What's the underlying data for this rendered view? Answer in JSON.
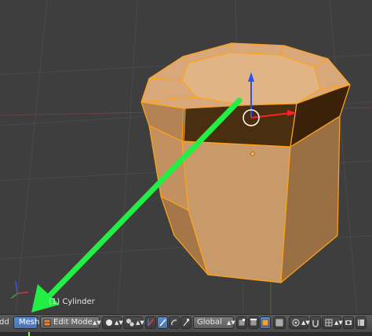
{
  "viewport": {
    "object_name": "(1) Cylinder"
  },
  "header": {
    "left_clip": "dd",
    "menu_mesh": "Mesh",
    "mode": "Edit Mode",
    "orientation": "Global"
  },
  "colors": {
    "mesh_face": "#c89a6a",
    "mesh_edge": "#ffa31a",
    "selected_face": "#4a2e0e",
    "annotation_arrow": "#22ee44",
    "gizmo_z": "#2a50ff",
    "gizmo_x": "#ff2222",
    "active_button": "#5e8bcc"
  },
  "icons": [
    "mode-selector-icon",
    "viewport-shading-icon",
    "pivot-icon",
    "manipulator-hand-icon",
    "translate-gizmo-icon",
    "rotate-gizmo-icon",
    "scale-gizmo-icon",
    "vertex-select-icon",
    "edge-select-icon",
    "face-select-icon",
    "proportional-edit-icon",
    "snap-icon",
    "render-icon"
  ]
}
